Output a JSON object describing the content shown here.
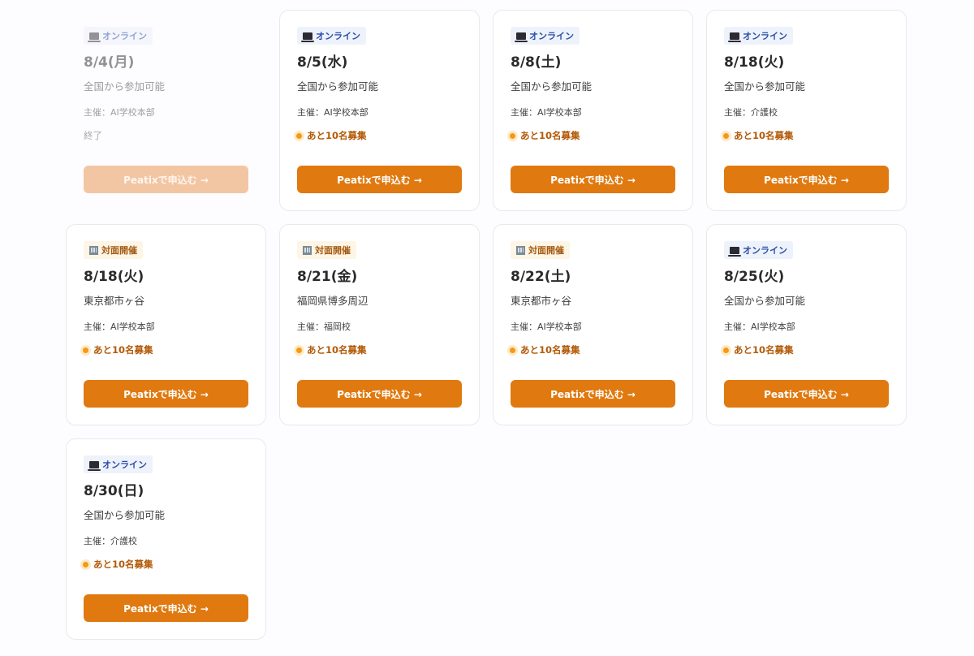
{
  "colors": {
    "cta": "#e0790f",
    "cta_disabled": "#f2c6a3",
    "online_badge_bg": "#eef2fb",
    "online_badge_text": "#2a4fa8",
    "offline_badge_bg": "#fdf5e6",
    "offline_badge_text": "#a45a10",
    "status_text": "#b35a08"
  },
  "events": [
    {
      "badge": "オンライン",
      "badge_type": "online",
      "icon": "laptop-icon",
      "date": "8/4(月)",
      "location": "全国から参加可能",
      "host": "主催：AI学校本部",
      "status": "終了",
      "status_type": "ended",
      "cta": "Peatixで申込む →",
      "cta_enabled": false
    },
    {
      "badge": "オンライン",
      "badge_type": "online",
      "icon": "laptop-icon",
      "date": "8/5(水)",
      "location": "全国から参加可能",
      "host": "主催：AI学校本部",
      "status": "あと10名募集",
      "status_type": "open",
      "cta": "Peatixで申込む →",
      "cta_enabled": true
    },
    {
      "badge": "オンライン",
      "badge_type": "online",
      "icon": "laptop-icon",
      "date": "8/8(土)",
      "location": "全国から参加可能",
      "host": "主催：AI学校本部",
      "status": "あと10名募集",
      "status_type": "open",
      "cta": "Peatixで申込む →",
      "cta_enabled": true
    },
    {
      "badge": "オンライン",
      "badge_type": "online",
      "icon": "laptop-icon",
      "date": "8/18(火)",
      "location": "全国から参加可能",
      "host": "主催：介護校",
      "status": "あと10名募集",
      "status_type": "open",
      "cta": "Peatixで申込む →",
      "cta_enabled": true
    },
    {
      "badge": "対面開催",
      "badge_type": "offline",
      "icon": "building-icon",
      "date": "8/18(火)",
      "location": "東京都市ヶ谷",
      "host": "主催：AI学校本部",
      "status": "あと10名募集",
      "status_type": "open",
      "cta": "Peatixで申込む →",
      "cta_enabled": true
    },
    {
      "badge": "対面開催",
      "badge_type": "offline",
      "icon": "building-icon",
      "date": "8/21(金)",
      "location": "福岡県博多周辺",
      "host": "主催：福岡校",
      "status": "あと10名募集",
      "status_type": "open",
      "cta": "Peatixで申込む →",
      "cta_enabled": true
    },
    {
      "badge": "対面開催",
      "badge_type": "offline",
      "icon": "building-icon",
      "date": "8/22(土)",
      "location": "東京都市ヶ谷",
      "host": "主催：AI学校本部",
      "status": "あと10名募集",
      "status_type": "open",
      "cta": "Peatixで申込む →",
      "cta_enabled": true
    },
    {
      "badge": "オンライン",
      "badge_type": "online",
      "icon": "laptop-icon",
      "date": "8/25(火)",
      "location": "全国から参加可能",
      "host": "主催：AI学校本部",
      "status": "あと10名募集",
      "status_type": "open",
      "cta": "Peatixで申込む →",
      "cta_enabled": true
    },
    {
      "badge": "オンライン",
      "badge_type": "online",
      "icon": "laptop-icon",
      "date": "8/30(日)",
      "location": "全国から参加可能",
      "host": "主催：介護校",
      "status": "あと10名募集",
      "status_type": "open",
      "cta": "Peatixで申込む →",
      "cta_enabled": true
    }
  ]
}
